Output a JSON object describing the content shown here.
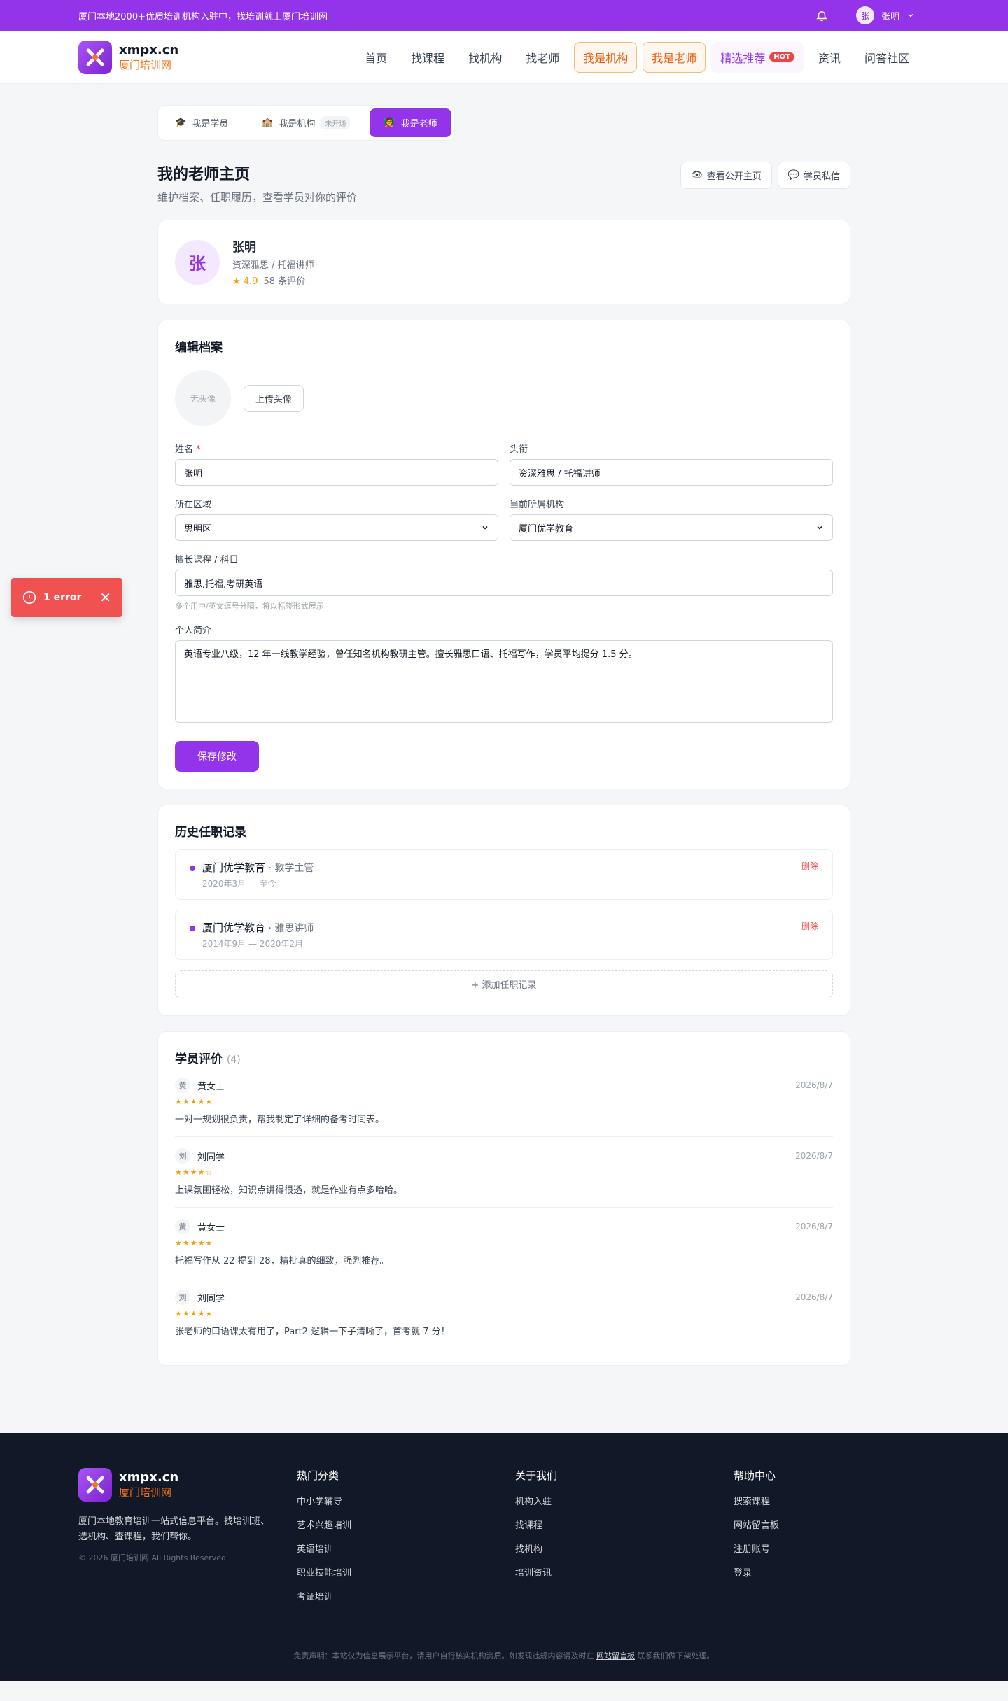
{
  "topbar": {
    "announcement": "厦门本地2000+优质培训机构入驻中，找培训就上厦门培训网",
    "user_avatar": "张",
    "user_name": "张明"
  },
  "header": {
    "logo_title": "xmpx.cn",
    "logo_subtitle": "厦门培训网",
    "nav": [
      "首页",
      "找课程",
      "找机构",
      "找老师",
      "我是机构",
      "我是老师",
      "精选推荐",
      "资讯",
      "问答社区"
    ],
    "hot_badge": "HOT"
  },
  "roles": [
    {
      "label": "我是学员",
      "icon": "graduation-cap-icon"
    },
    {
      "label": "我是机构",
      "tag": "未开通",
      "icon": "building-icon"
    },
    {
      "label": "我是老师",
      "icon": "teacher-icon"
    }
  ],
  "page": {
    "title": "我的老师主页",
    "subtitle": "维护档案、任职履历，查看学员对你的评价",
    "view_public": "查看公开主页",
    "messages": "学员私信"
  },
  "profile": {
    "avatar": "张",
    "name": "张明",
    "title": "资深雅思 / 托福讲师",
    "score": "★ 4.9",
    "reviews": "58 条评价"
  },
  "edit": {
    "title": "编辑档案",
    "no_avatar": "无头像",
    "upload": "上传头像",
    "name_label": "姓名",
    "name_req": "*",
    "name_value": "张明",
    "title_label": "头衔",
    "title_value": "资深雅思 / 托福讲师",
    "region_label": "所在区域",
    "region_value": "思明区",
    "org_label": "当前所属机构",
    "org_value": "厦门优学教育",
    "subjects_label": "擅长课程 / 科目",
    "subjects_value": "雅思,托福,考研英语",
    "subjects_hint": "多个用中/英文逗号分隔，将以标签形式展示",
    "bio_label": "个人简介",
    "bio_value": "英语专业八级，12 年一线教学经验，曾任知名机构教研主管。擅长雅思口语、托福写作，学员平均提分 1.5 分。",
    "save": "保存修改"
  },
  "history": {
    "title": "历史任职记录",
    "items": [
      {
        "org": "厦门优学教育",
        "role": " · 教学主管",
        "date": "2020年3月 — 至今",
        "delete": "删除"
      },
      {
        "org": "厦门优学教育",
        "role": " · 雅思讲师",
        "date": "2014年9月 — 2020年2月",
        "delete": "删除"
      }
    ],
    "add": "+ 添加任职记录"
  },
  "reviews": {
    "title": "学员评价",
    "count": "(4)",
    "items": [
      {
        "avatar": "黄",
        "name": "黄女士",
        "date": "2026/8/7",
        "stars": "★★★★★",
        "text": "一对一规划很负责，帮我制定了详细的备考时间表。"
      },
      {
        "avatar": "刘",
        "name": "刘同学",
        "date": "2026/8/7",
        "stars": "★★★★☆",
        "text": "上课氛围轻松，知识点讲得很透，就是作业有点多哈哈。"
      },
      {
        "avatar": "黄",
        "name": "黄女士",
        "date": "2026/8/7",
        "stars": "★★★★★",
        "text": "托福写作从 22 提到 28，精批真的细致，强烈推荐。"
      },
      {
        "avatar": "刘",
        "name": "刘同学",
        "date": "2026/8/7",
        "stars": "★★★★★",
        "text": "张老师的口语课太有用了，Part2 逻辑一下子清晰了，首考就 7 分！"
      }
    ]
  },
  "toast": {
    "text": "1 error"
  },
  "footer": {
    "desc": "厦门本地教育培训一站式信息平台。找培训班、选机构、查课程，我们帮你。",
    "copyright": "© 2026 厦门培训网 All Rights Reserved",
    "cols": [
      {
        "title": "热门分类",
        "links": [
          "中小学辅导",
          "艺术兴趣培训",
          "英语培训",
          "职业技能培训",
          "考证培训"
        ]
      },
      {
        "title": "关于我们",
        "links": [
          "机构入驻",
          "找课程",
          "找机构",
          "培训资讯"
        ]
      },
      {
        "title": "帮助中心",
        "links": [
          "搜索课程",
          "网站留言板",
          "注册账号",
          "登录"
        ]
      }
    ],
    "disclaimer_pre": "免责声明：本站仅为信息展示平台，请用户自行核实机构资质。如发现违规内容请及时在",
    "disclaimer_link": "网站留言板",
    "disclaimer_post": "联系我们做下架处理。"
  },
  "colors": {
    "brand": "#9333ea",
    "accent": "#f97316",
    "error": "#f05252"
  }
}
